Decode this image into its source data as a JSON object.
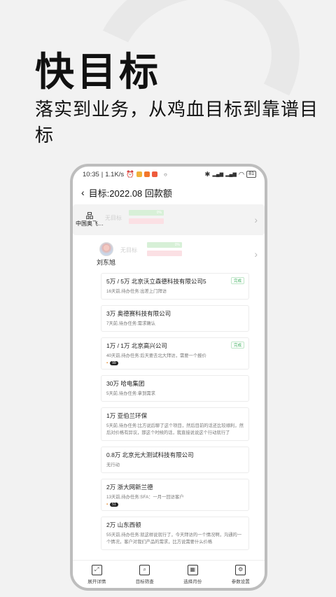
{
  "promo": {
    "title": "快目标",
    "subtitle": "落实到业务，从鸡血目标到靠谱目标"
  },
  "status_bar": {
    "time": "10:35",
    "speed": "1.1K/s",
    "battery": "81"
  },
  "nav": {
    "title": "目标:2022.08 回款额"
  },
  "org_row": {
    "name": "中国奥飞…",
    "ghost_label": "无目标",
    "green_bar_label": "0%"
  },
  "person_row": {
    "name": "刘东旭",
    "ghost_label": "无目标",
    "green_bar_label": "0%"
  },
  "cards": [
    {
      "title": "5万  / 5万  北京沃立森德科技有限公司5",
      "desc": "16天前,待办任务:出差上门拜访",
      "tag": "完成"
    },
    {
      "title": "3万  奥德赛科技有限公司",
      "desc": "7天前,待办任务:需求确认"
    },
    {
      "title": "1万  / 1万  北京高兴公司",
      "desc": "40天前,待办任务:后天要去北大拜访，需要一个报价",
      "tag": "完成",
      "count": "99"
    },
    {
      "title": "30万  哈电集团",
      "desc": "5天前,待办任务:拿到需求"
    },
    {
      "title": "1万  亚伯兰环保",
      "desc": "5天前,待办任务:比方说后聊了这个项目，然后目前的话还比较顺利，然后对价格有异议，那这个时候的话，我直接说说这个行动就行了"
    },
    {
      "title": "0.8万  北京光大测试科技有限公司",
      "desc": "无行动"
    },
    {
      "title": "2万  浙大网新兰德",
      "desc": "13天前,待办任务:SFA：一月一回访客户",
      "count": "51"
    },
    {
      "title": "2万  山东西顿",
      "desc": "55天前,待办任务:就这样说就行了，今天拜访的一个情况啊，沟通的一个情况，客户对我们产品的需求，比方说需要什么价格"
    }
  ],
  "tabbar": [
    {
      "label": "展开详情",
      "icon": "expand-icon"
    },
    {
      "label": "目标筛查",
      "icon": "search-icon"
    },
    {
      "label": "选择月份",
      "icon": "calendar-icon"
    },
    {
      "label": "参数设置",
      "icon": "gear-icon"
    }
  ]
}
